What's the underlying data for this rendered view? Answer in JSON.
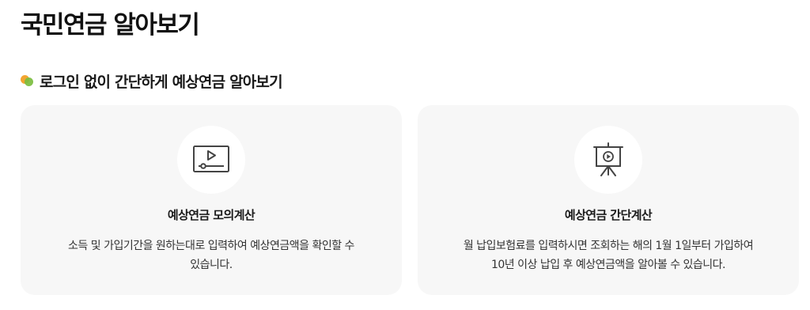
{
  "page": {
    "title": "국민연금 알아보기"
  },
  "section": {
    "heading": "로그인 없이 간단하게 예상연금 알아보기",
    "bullet_icon": "overlapping-circles-icon",
    "colors": {
      "orange": "#f2a531",
      "green": "#7bbd3f"
    }
  },
  "cards": [
    {
      "icon": "video-player-icon",
      "title": "예상연금 모의계산",
      "desc_line1": "소득 및 가입기간을 원하는대로 입력하여 예상연금액을 확인할 수",
      "desc_line2": "있습니다."
    },
    {
      "icon": "presentation-board-icon",
      "title": "예상연금 간단계산",
      "desc_line1": "월 납입보험료를 입력하시면 조회하는 해의 1월 1일부터 가입하여",
      "desc_line2": "10년 이상 납입 후 예상연금액을 알아볼 수 있습니다."
    }
  ]
}
